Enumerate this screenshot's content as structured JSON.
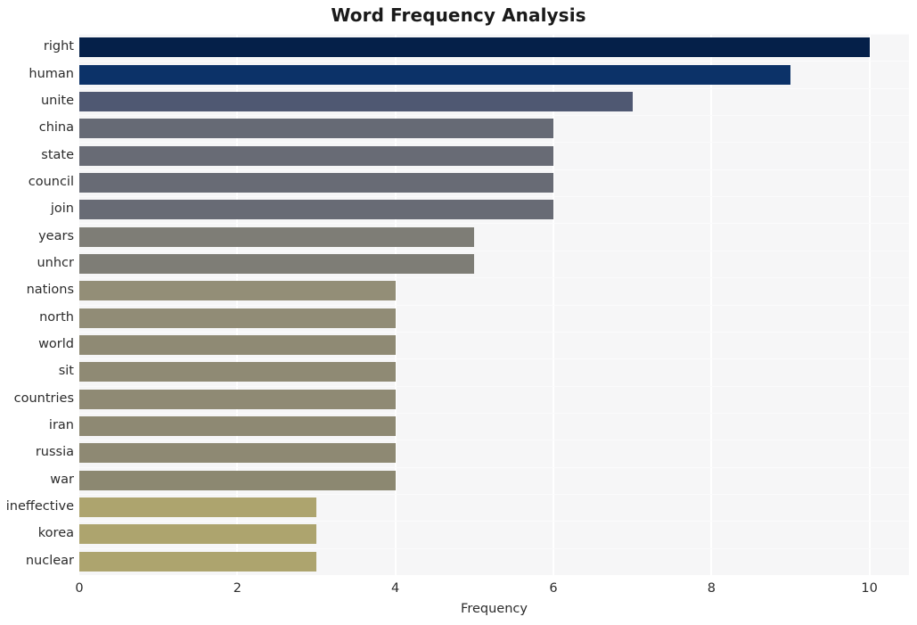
{
  "chart_data": {
    "type": "bar",
    "orientation": "horizontal",
    "title": "Word Frequency Analysis",
    "xlabel": "Frequency",
    "ylabel": "",
    "categories": [
      "right",
      "human",
      "unite",
      "china",
      "state",
      "council",
      "join",
      "years",
      "unhcr",
      "nations",
      "north",
      "world",
      "sit",
      "countries",
      "iran",
      "russia",
      "war",
      "ineffective",
      "korea",
      "nuclear"
    ],
    "values": [
      10,
      9,
      7,
      6,
      6,
      6,
      6,
      5,
      5,
      4,
      4,
      4,
      4,
      4,
      4,
      4,
      4,
      3,
      3,
      3
    ],
    "bar_colors": [
      "#052049",
      "#0c3268",
      "#4f5872",
      "#666a75",
      "#686b75",
      "#686b75",
      "#686b75",
      "#7e7d76",
      "#7e7d76",
      "#938e77",
      "#918c76",
      "#8f8a74",
      "#8f8a74",
      "#8f8a74",
      "#8e8973",
      "#8e8973",
      "#8c8871",
      "#ada46e",
      "#ada46e",
      "#ada46e"
    ],
    "xlim": [
      0,
      10.5
    ],
    "xticks": [
      "0",
      "2",
      "4",
      "6",
      "8",
      "10"
    ],
    "xtick_values": [
      0,
      2,
      4,
      6,
      8,
      10
    ],
    "grid": true,
    "grid_axis": "x",
    "legend": false,
    "plot_background": "#f6f6f7",
    "figure_background": "#ffffff",
    "gridline_color": "#ffffff",
    "tick_label_color": "#2b2b2b"
  }
}
